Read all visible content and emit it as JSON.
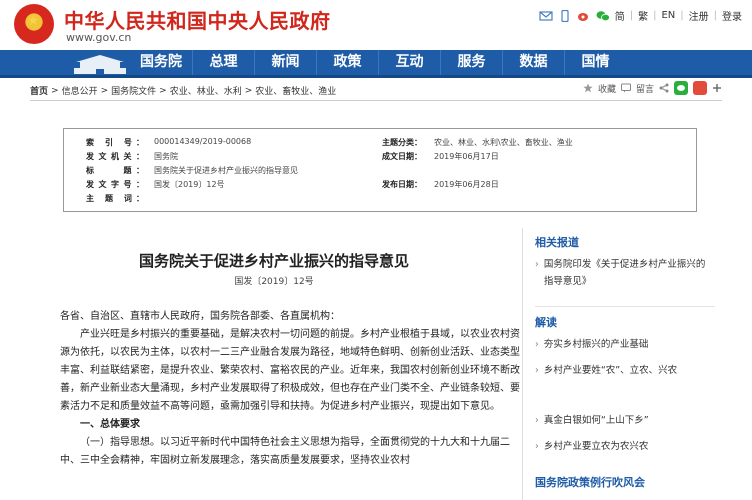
{
  "header": {
    "site_title": "中华人民共和国中央人民政府",
    "site_url": "www.gov.cn",
    "top_links": [
      "简",
      "繁",
      "EN",
      "注册",
      "登录"
    ]
  },
  "nav": {
    "items": [
      "国务院",
      "总理",
      "新闻",
      "政策",
      "互动",
      "服务",
      "数据",
      "国情"
    ]
  },
  "breadcrumb": {
    "items": [
      "首页",
      "信息公开",
      "国务院文件",
      "农业、林业、水利",
      "农业、畜牧业、渔业"
    ],
    "separator": ">"
  },
  "tools": {
    "favorite": "收藏",
    "comment": "留言"
  },
  "meta": {
    "index_label": "索 引 号：",
    "index_value": "000014349/2019-00068",
    "issuer_label": "发文机关：",
    "issuer_value": "国务院",
    "title_label": "标　　题：",
    "title_value": "国务院关于促进乡村产业振兴的指导意见",
    "docno_label": "发文字号：",
    "docno_value": "国发〔2019〕12号",
    "keywords_label": "主 题 词：",
    "keywords_value": "",
    "category_label": "主题分类：",
    "category_value": "农业、林业、水利\\农业、畜牧业、渔业",
    "date_label": "成文日期：",
    "date_value": "2019年06月17日",
    "publish_label": "发布日期：",
    "publish_value": "2019年06月28日"
  },
  "article": {
    "title": "国务院关于促进乡村产业振兴的指导意见",
    "doc_number": "国发〔2019〕12号",
    "salutation": "各省、自治区、直辖市人民政府，国务院各部委、各直属机构：",
    "para1": "产业兴旺是乡村振兴的重要基础，是解决农村一切问题的前提。乡村产业根植于县域，以农业农村资源为依托，以农民为主体，以农村一二三产业融合发展为路径，地域特色鲜明、创新创业活跃、业态类型丰富、利益联结紧密，是提升农业、繁荣农村、富裕农民的产业。近年来，我国农村创新创业环境不断改善，新产业新业态大量涌现，乡村产业发展取得了积极成效，但也存在产业门类不全、产业链条较短、要素活力不足和质量效益不高等问题，亟需加强引导和扶持。为促进乡村产业振兴，现提出如下意见。",
    "section1": "一、总体要求",
    "para2": "（一）指导思想。以习近平新时代中国特色社会主义思想为指导，全面贯彻党的十九大和十九届二中、三中全会精神，牢固树立新发展理念，落实高质量发展要求，坚持农业农村"
  },
  "sidebar": {
    "related_heading": "相关报道",
    "related_items": [
      "国务院印发《关于促进乡村产业振兴的指导意见》"
    ],
    "interpret_heading": "解读",
    "interpret_items": [
      "夯实乡村振兴的产业基础",
      "乡村产业要姓“农”、立农、兴农",
      "真金白银如何“上山下乡”",
      "乡村产业要立农为农兴农"
    ],
    "policy_heading": "国务院政策例行吹风会"
  },
  "colors": {
    "brand_red": "#d0261c",
    "nav_blue": "#1f5ca8",
    "sidebar_heading": "#1f5ca8"
  }
}
